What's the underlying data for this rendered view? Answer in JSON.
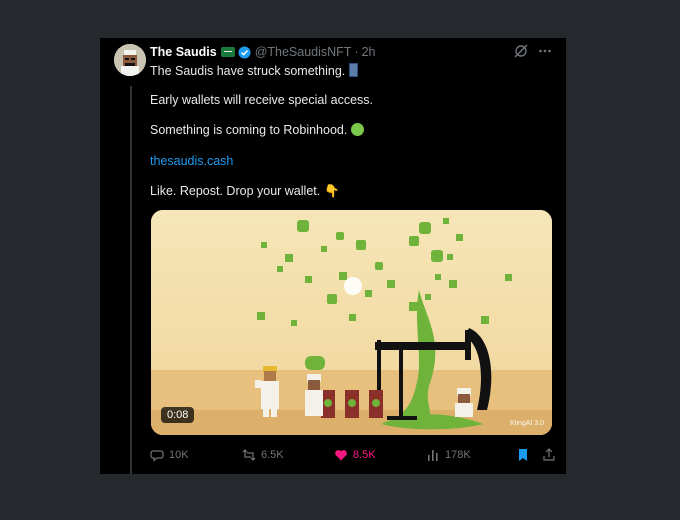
{
  "tweet": {
    "display_name": "The Saudis",
    "handle": "@TheSaudisNFT",
    "separator": "·",
    "time_ago": "2h",
    "lines": [
      "The Saudis have struck something.",
      "Early wallets will receive special access.",
      "Something is coming to Robinhood.",
      "thesaudis.cash",
      "Like. Repost. Drop your wallet."
    ],
    "hand_emoji": "👇"
  },
  "media": {
    "duration": "0:08",
    "watermark": "KlingAI 3.0"
  },
  "actions": {
    "replies": "10K",
    "reposts": "6.5K",
    "likes": "8.5K",
    "views": "178K"
  },
  "colors": {
    "link": "#1d9bf0",
    "like": "#f91880",
    "bookmark": "#1d9bf0",
    "oil": "#8ccf3d"
  }
}
